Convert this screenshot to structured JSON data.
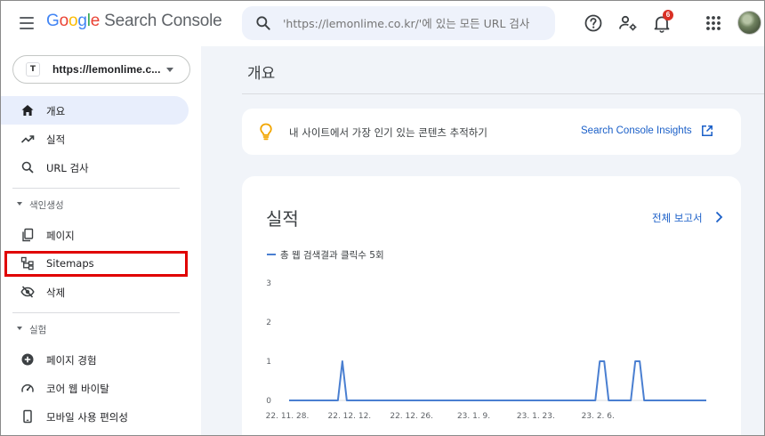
{
  "app": {
    "logo_letters": [
      "G",
      "o",
      "o",
      "g",
      "l",
      "e"
    ],
    "product_name": "Search Console"
  },
  "search": {
    "placeholder": "'https://lemonlime.co.kr/'에 있는 모든 URL 검사"
  },
  "notifications": {
    "count": "6"
  },
  "icons": {
    "menu": "hamburger-icon",
    "search": "search-icon",
    "help": "help-icon",
    "user_settings": "manage-account-icon",
    "notifications": "bell-icon",
    "apps": "apps-grid-icon"
  },
  "property": {
    "name": "https://lemonlime.c...",
    "favicon": "T"
  },
  "sidebar": {
    "top_items": [
      {
        "label": "개요",
        "icon": "home-icon",
        "active": true
      },
      {
        "label": "실적",
        "icon": "trending-up-icon"
      },
      {
        "label": "URL 검사",
        "icon": "search-icon"
      }
    ],
    "indexing": {
      "label": "색인생성",
      "items": [
        {
          "label": "페이지",
          "icon": "pages-icon"
        },
        {
          "label": "Sitemaps",
          "icon": "sitemap-icon"
        },
        {
          "label": "삭제",
          "icon": "visibility-off-icon"
        }
      ]
    },
    "experience": {
      "label": "실험",
      "items": [
        {
          "label": "페이지 경험",
          "icon": "plus-circle-icon"
        },
        {
          "label": "코어 웹 바이탈",
          "icon": "speedometer-icon"
        },
        {
          "label": "모바일 사용 편의성",
          "icon": "smartphone-icon"
        }
      ]
    }
  },
  "main": {
    "title": "개요",
    "insight": {
      "text": "내 사이트에서 가장 인기 있는 콘텐츠 추적하기",
      "link": "Search Console Insights"
    },
    "performance": {
      "title": "실적",
      "report_link": "전체 보고서"
    }
  },
  "colors": {
    "accent": "#1a5fc8",
    "active_bg": "#e8eefc",
    "line": "#4a7fd1",
    "highlight": "#e00000"
  },
  "chart_data": {
    "type": "line",
    "series": [
      {
        "name": "총 웹 검색결과 클릭수 5회",
        "values": [
          0,
          0,
          0,
          0,
          0,
          0,
          0,
          0,
          0,
          0,
          0,
          0,
          1,
          0,
          0,
          0,
          0,
          0,
          0,
          0,
          0,
          0,
          0,
          0,
          0,
          0,
          0,
          0,
          0,
          0,
          0,
          0,
          0,
          0,
          0,
          0,
          0,
          0,
          0,
          0,
          0,
          0,
          0,
          0,
          0,
          0,
          0,
          0,
          0,
          0,
          0,
          0,
          0,
          0,
          0,
          0,
          0,
          0,
          0,
          0,
          0,
          0,
          0,
          0,
          0,
          0,
          0,
          0,
          0,
          0,
          1,
          1,
          0,
          0,
          0,
          0,
          0,
          0,
          1,
          1,
          0,
          0,
          0,
          0,
          0,
          0,
          0,
          0,
          0,
          0,
          0,
          0,
          0,
          0,
          0
        ]
      }
    ],
    "x_start_label": "22. 11. 28.",
    "tick_labels": [
      "22. 11. 28.",
      "22. 12. 12.",
      "22. 12. 26.",
      "23. 1. 9.",
      "23. 1. 23.",
      "23. 2. 6."
    ],
    "y_ticks": [
      "0",
      "1",
      "2",
      "3"
    ],
    "ylim": [
      0,
      3
    ],
    "grid": false,
    "legend": "top-left"
  }
}
